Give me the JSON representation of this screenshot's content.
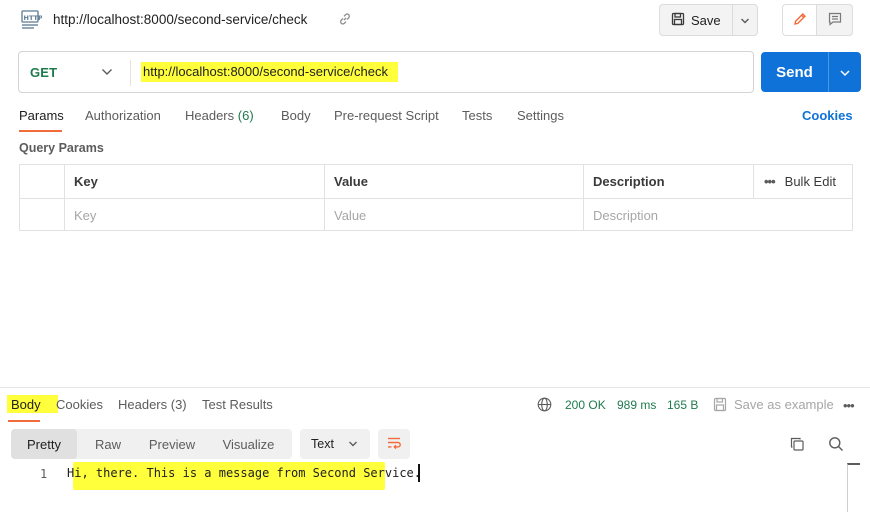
{
  "request": {
    "title": "http://localhost:8000/second-service/check",
    "method": "GET",
    "url": "http://localhost:8000/second-service/check"
  },
  "toolbar": {
    "save_label": "Save",
    "send_label": "Send"
  },
  "request_tabs": {
    "params": "Params",
    "authorization": "Authorization",
    "headers": "Headers",
    "headers_count": "(6)",
    "body": "Body",
    "prerequest": "Pre-request Script",
    "tests": "Tests",
    "settings": "Settings",
    "cookies": "Cookies"
  },
  "query_params": {
    "title": "Query Params",
    "headers": {
      "key": "Key",
      "value": "Value",
      "description": "Description",
      "bulk_edit": "Bulk Edit"
    },
    "placeholders": {
      "key": "Key",
      "value": "Value",
      "description": "Description"
    }
  },
  "response": {
    "tabs": {
      "body": "Body",
      "cookies": "Cookies",
      "headers": "Headers (3)",
      "test_results": "Test Results"
    },
    "status": "200 OK",
    "time": "989 ms",
    "size": "165 B",
    "save_as_example": "Save as example",
    "views": [
      "Pretty",
      "Raw",
      "Preview",
      "Visualize"
    ],
    "format": "Text",
    "line_number": "1",
    "content": "Hi, there. This is a message from Second Service."
  },
  "colors": {
    "accent": "#f26b3a",
    "send_blue": "#0f72d8",
    "method_green": "#1f7a4d",
    "highlight": "#ffff3c"
  },
  "icons": [
    "http-icon",
    "link-icon",
    "save-icon",
    "chevron-down-icon",
    "pencil-icon",
    "comment-icon",
    "more-icon",
    "globe-icon",
    "wrap-lines-icon",
    "copy-icon",
    "search-icon"
  ]
}
